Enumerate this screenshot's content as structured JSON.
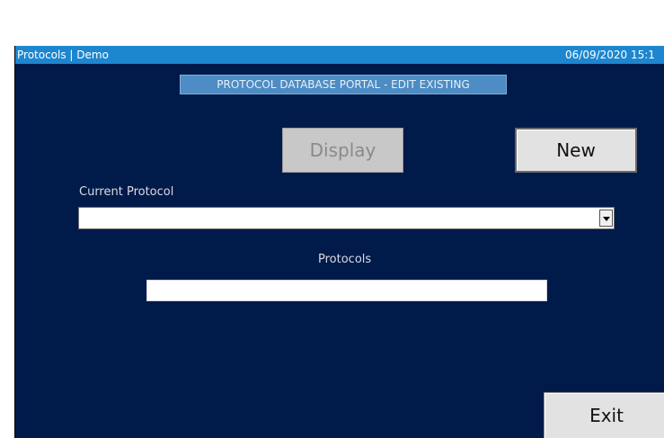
{
  "window": {
    "title": "Protocols | Demo",
    "datetime": "06/09/2020 15:1"
  },
  "header": {
    "banner": "PROTOCOL DATABASE PORTAL - EDIT EXISTING"
  },
  "buttons": {
    "display": "Display",
    "new": "New",
    "exit": "Exit"
  },
  "form": {
    "current_protocol_label": "Current Protocol",
    "current_protocol_value": "",
    "protocols_label": "Protocols",
    "protocols_value": ""
  },
  "colors": {
    "background": "#001a4a",
    "titlebar": "#1d86cf",
    "banner": "#4d8cc4"
  }
}
